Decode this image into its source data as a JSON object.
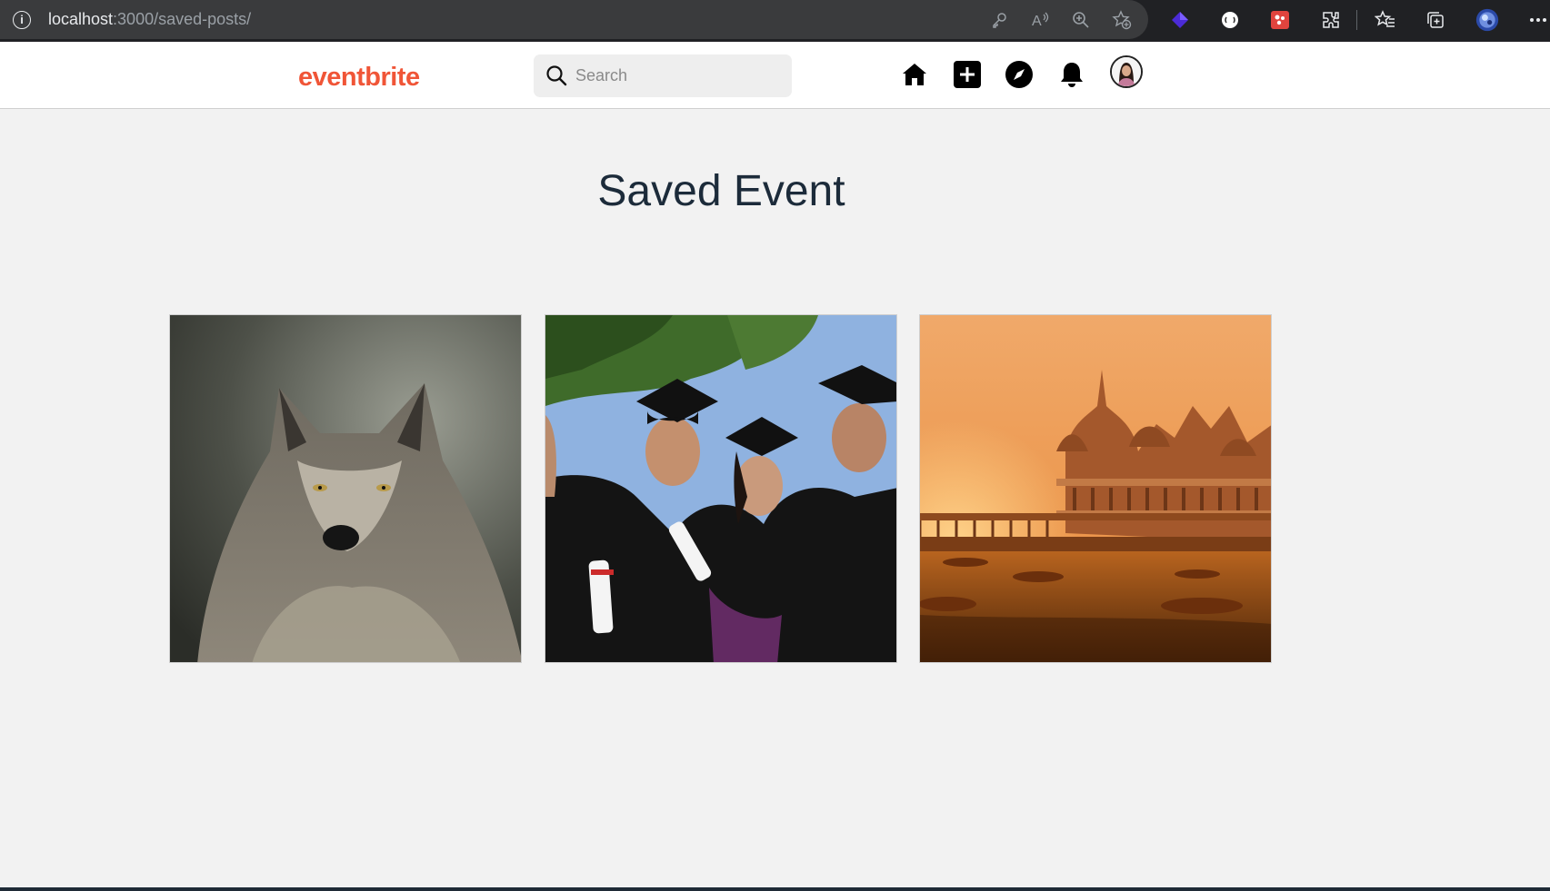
{
  "browser": {
    "url_host": "localhost",
    "url_path": ":3000/saved-posts/",
    "toolbar_icons": [
      "key-icon",
      "read-aloud-icon",
      "zoom-icon",
      "add-favorite-icon",
      "extension-purple-icon",
      "extension-circle-icon",
      "extension-red-icon",
      "extensions-icon",
      "favorites-icon",
      "collections-icon",
      "profile-icon",
      "more-icon"
    ]
  },
  "header": {
    "logo": "eventbrite",
    "search": {
      "placeholder": "Search",
      "value": ""
    },
    "nav_icons": [
      "home-icon",
      "create-icon",
      "explore-icon",
      "notifications-icon",
      "avatar"
    ]
  },
  "main": {
    "title": "Saved Event",
    "events": [
      {
        "image": "wolf-photo"
      },
      {
        "image": "graduates-photo"
      },
      {
        "image": "temple-sunset-photo"
      }
    ]
  },
  "colors": {
    "brand": "#f05537",
    "title": "#1c2b3a",
    "background": "#f2f2f2"
  }
}
